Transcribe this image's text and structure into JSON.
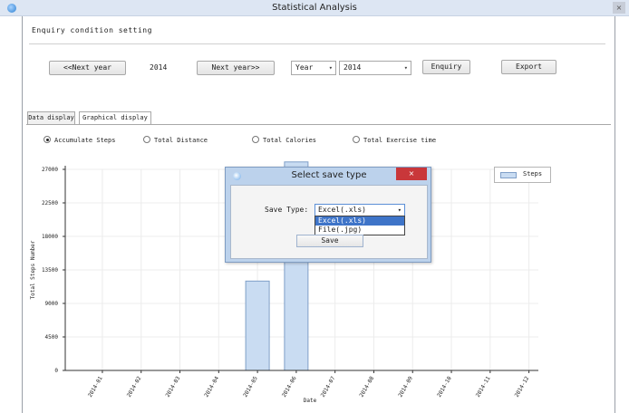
{
  "window": {
    "title": "Statistical Analysis",
    "close_glyph": "×"
  },
  "query": {
    "section_title": "Enquiry condition setting",
    "prev_year_label": "<<Next year",
    "current_year": "2014",
    "next_year_label": "Next year>>",
    "period_select": "Year",
    "year_select": "2014",
    "enquiry_label": "Enquiry",
    "export_label": "Export"
  },
  "tabs": [
    {
      "label": "Data display",
      "active": false
    },
    {
      "label": "Graphical display",
      "active": true
    }
  ],
  "radios": [
    {
      "label": "Accumulate Steps",
      "checked": true
    },
    {
      "label": "Total Distance",
      "checked": false
    },
    {
      "label": "Total Calories",
      "checked": false
    },
    {
      "label": "Total Exercise time",
      "checked": false
    }
  ],
  "legend": {
    "label": "Steps"
  },
  "chart_data": {
    "type": "bar",
    "ylabel": "Total Steps Number",
    "xlabel": "Date",
    "ylim": [
      0,
      27000
    ],
    "yticks": [
      0,
      4500,
      9000,
      13500,
      18000,
      22500,
      27000
    ],
    "categories": [
      "2014-01",
      "2014-02",
      "2014-03",
      "2014-04",
      "2014-05",
      "2014-06",
      "2014-07",
      "2014-08",
      "2014-09",
      "2014-10",
      "2014-11",
      "2014-12"
    ],
    "series": [
      {
        "name": "Steps",
        "values": [
          0,
          0,
          0,
          0,
          12000,
          28000,
          0,
          0,
          0,
          0,
          0,
          0
        ]
      }
    ],
    "grid": true,
    "legend_position": "top-right",
    "bar_color": "#c9dcf2",
    "bar_edge_color": "#7f9fc8"
  },
  "dialog": {
    "title": "Select save type",
    "close_glyph": "×",
    "save_type_label": "Save Type:",
    "selected_value": "Excel(.xls)",
    "options": [
      "Excel(.xls)",
      "File(.jpg)"
    ],
    "save_label": "Save"
  }
}
